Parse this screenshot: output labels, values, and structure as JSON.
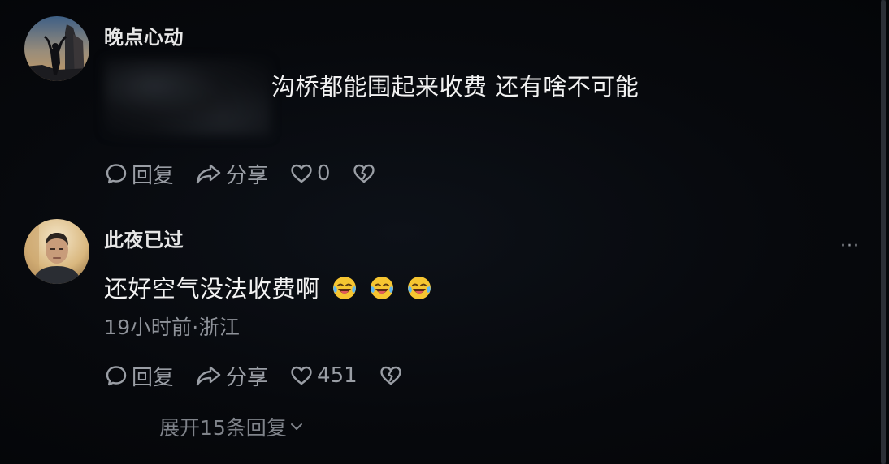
{
  "comments": [
    {
      "username": "晚点心动",
      "text": "沟桥都能围起来收费 还有啥不可能",
      "reply_label": "回复",
      "share_label": "分享",
      "like_count": "0"
    },
    {
      "username": "此夜已过",
      "text": "还好空气没法收费啊",
      "emojis": [
        "laugh-cry-emoji",
        "laugh-cry-emoji",
        "laugh-cry-emoji"
      ],
      "meta": "19小时前·浙江",
      "reply_label": "回复",
      "share_label": "分享",
      "like_count": "451",
      "expand_label": "展开15条回复"
    }
  ],
  "more_label": "···",
  "colors": {
    "background": "#05070b",
    "text": "#f2f2f2",
    "muted": "#9a9ea5"
  }
}
